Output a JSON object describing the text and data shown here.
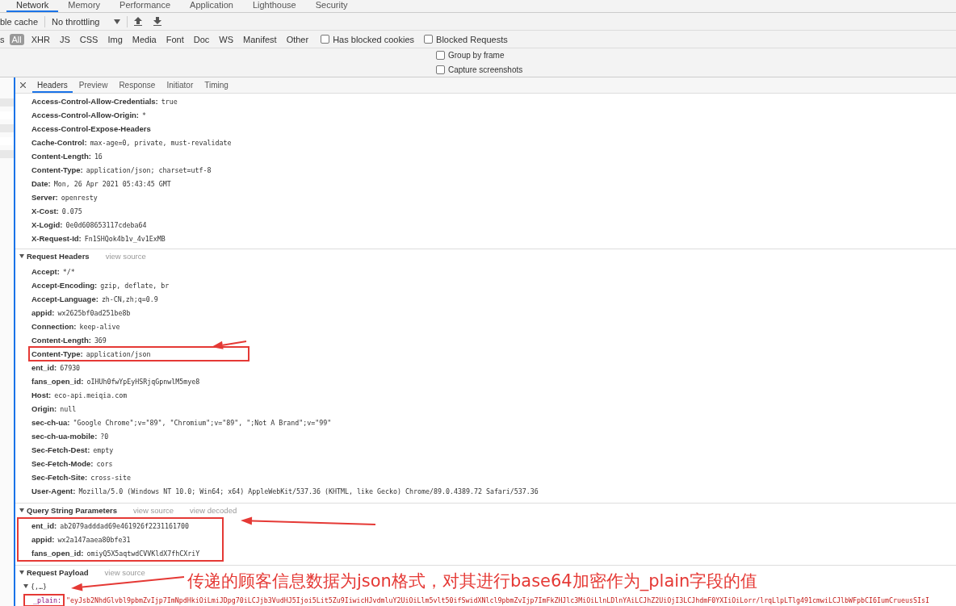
{
  "panel_tabs": [
    {
      "label": "Network",
      "selected": true
    },
    {
      "label": "Memory",
      "selected": false
    },
    {
      "label": "Performance",
      "selected": false
    },
    {
      "label": "Application",
      "selected": false
    },
    {
      "label": "Lighthouse",
      "selected": false
    },
    {
      "label": "Security",
      "selected": false
    }
  ],
  "toolbar": {
    "cache_label": "ble cache",
    "throttling": "No throttling"
  },
  "filters": {
    "lead": "s",
    "types": [
      {
        "label": "All",
        "selected": true
      },
      {
        "label": "XHR",
        "selected": false
      },
      {
        "label": "JS",
        "selected": false
      },
      {
        "label": "CSS",
        "selected": false
      },
      {
        "label": "Img",
        "selected": false
      },
      {
        "label": "Media",
        "selected": false
      },
      {
        "label": "Font",
        "selected": false
      },
      {
        "label": "Doc",
        "selected": false
      },
      {
        "label": "WS",
        "selected": false
      },
      {
        "label": "Manifest",
        "selected": false
      },
      {
        "label": "Other",
        "selected": false
      }
    ],
    "checkboxes": [
      {
        "label": "Has blocked cookies",
        "checked": false
      },
      {
        "label": "Blocked Requests",
        "checked": false
      }
    ]
  },
  "options": [
    {
      "label": "Group by frame",
      "checked": false
    },
    {
      "label": "Capture screenshots",
      "checked": false
    }
  ],
  "detail_tabs": [
    {
      "label": "Headers",
      "selected": true
    },
    {
      "label": "Preview",
      "selected": false
    },
    {
      "label": "Response",
      "selected": false
    },
    {
      "label": "Initiator",
      "selected": false
    },
    {
      "label": "Timing",
      "selected": false
    }
  ],
  "response_headers": [
    {
      "name": "Access-Control-Allow-Credentials:",
      "value": "true",
      "outlined": false
    },
    {
      "name": "Access-Control-Allow-Origin:",
      "value": "*",
      "outlined": false
    },
    {
      "name": "Access-Control-Expose-Headers",
      "outlined": false
    },
    {
      "name": "Cache-Control:",
      "value": "max-age=0, private, must-revalidate",
      "outlined": false
    },
    {
      "name": "Content-Length:",
      "value": "16",
      "outlined": false
    },
    {
      "name": "Content-Type:",
      "value": "application/json; charset=utf-8",
      "outlined": false
    },
    {
      "name": "Date:",
      "value": "Mon, 26 Apr 2021 05:43:45 GMT",
      "outlined": false
    },
    {
      "name": "Server:",
      "value": "openresty",
      "outlined": false
    },
    {
      "name": "X-Cost:",
      "value": "0.075",
      "outlined": false
    },
    {
      "name": "X-Logid:",
      "value": "0e0d608653117cdeba64",
      "outlined": false
    },
    {
      "name": "X-Request-Id:",
      "value": "Fn1SHQok4b1v_4v1ExMB",
      "outlined": false
    }
  ],
  "request_headers": {
    "title": "Request Headers",
    "links": [
      "view source"
    ],
    "outlined": false,
    "rows": [
      {
        "name": "Accept:",
        "value": "*/*",
        "outlined": false
      },
      {
        "name": "Accept-Encoding:",
        "value": "gzip, deflate, br",
        "outlined": false
      },
      {
        "name": "Accept-Language:",
        "value": "zh-CN,zh;q=0.9",
        "outlined": false
      },
      {
        "name": "appid:",
        "value": "wx2625bf0ad251be8b",
        "outlined": false
      },
      {
        "name": "Connection:",
        "value": "keep-alive",
        "outlined": false
      },
      {
        "name": "Content-Length:",
        "value": "369",
        "outlined": false
      },
      {
        "name": "Content-Type:",
        "value": "application/json",
        "outlined": true
      },
      {
        "name": "ent_id:",
        "value": "67930",
        "outlined": false
      },
      {
        "name": "fans_open_id:",
        "value": "oIHUh0fwYpEyHSRjqGpnwlM5mye8",
        "outlined": false
      },
      {
        "name": "Host:",
        "value": "eco-api.meiqia.com",
        "outlined": false
      },
      {
        "name": "Origin:",
        "value": "null",
        "outlined": false
      },
      {
        "name": "sec-ch-ua:",
        "value": "\"Google Chrome\";v=\"89\", \"Chromium\";v=\"89\", \";Not A Brand\";v=\"99\"",
        "outlined": false
      },
      {
        "name": "sec-ch-ua-mobile:",
        "value": "?0",
        "outlined": false
      },
      {
        "name": "Sec-Fetch-Dest:",
        "value": "empty",
        "outlined": false
      },
      {
        "name": "Sec-Fetch-Mode:",
        "value": "cors",
        "outlined": false
      },
      {
        "name": "Sec-Fetch-Site:",
        "value": "cross-site",
        "outlined": false
      },
      {
        "name": "User-Agent:",
        "value": "Mozilla/5.0 (Windows NT 10.0; Win64; x64) AppleWebKit/537.36 (KHTML, like Gecko) Chrome/89.0.4389.72 Safari/537.36",
        "outlined": false
      }
    ]
  },
  "query_params": {
    "title": "Query String Parameters",
    "links": [
      "view source",
      "view decoded"
    ],
    "outlined": true,
    "rows": [
      {
        "name": "ent_id:",
        "value": "ab2079adddad69e461926f2231161700",
        "outlined": false
      },
      {
        "name": "appid:",
        "value": "wx2a147aaea80bfe31",
        "outlined": false
      },
      {
        "name": "fans_open_id:",
        "value": "omiyQ5X5aqtwdCVVKldX7fhCXriY",
        "outlined": false
      }
    ]
  },
  "payload": {
    "title": "Request Payload",
    "links": [
      "view source"
    ],
    "summary": "{,…}",
    "key": "_plain:",
    "key_outlined": true,
    "value": "\"eyJsb2NhdGlvbl9pbmZvIjp7ImNpdHkiOiLmiJDpg70iLCJjb3VudHJ5Ijoi5Lit5Zu9IiwicHJvdmluY2UiOiLlm5vlt50ifSwidXNlcl9pbmZvIjp7ImFkZHJlc3MiOiLlnLDlnYAiLCJhZ2UiOjI3LCJhdmF0YXIiOiLorr/lrqLlpLTlg491cmwiLCJlbWFpbCI6IumCrueusSIsI"
  },
  "annotation_caption": "传递的顾客信息数据为json格式，对其进行base64加密作为_plain字段的值"
}
